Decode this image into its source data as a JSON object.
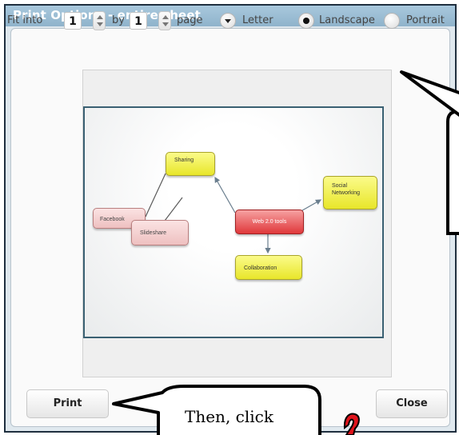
{
  "dialog": {
    "title": "Print Options - entire sheet"
  },
  "toolbar": {
    "fit_into_label": "Fit into",
    "pages_wide": "1",
    "by_label": "by",
    "pages_tall": "1",
    "page_label": "page",
    "paper_size": "Letter",
    "orientation_landscape": "Landscape",
    "orientation_portrait": "Portrait",
    "selected_orientation": "Landscape"
  },
  "preview": {
    "nodes": {
      "center": "Web 2.0 tools",
      "sharing": "Sharing",
      "facebook": "Facebook",
      "slideshare": "Slideshare",
      "social_line1": "Social",
      "social_line2": "Networking",
      "collaboration": "Collaboration"
    }
  },
  "buttons": {
    "print": "Print",
    "close": "Close"
  },
  "annotation": {
    "callout_text": "Then, click"
  }
}
